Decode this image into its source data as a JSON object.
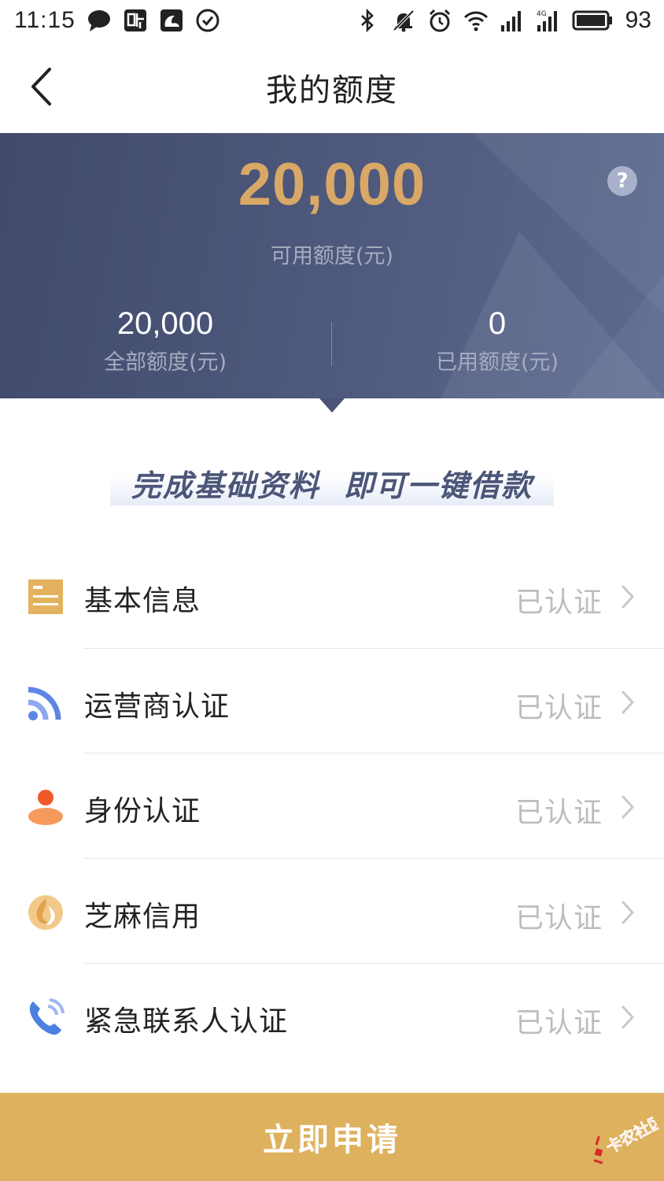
{
  "status_bar": {
    "time": "11:15",
    "left_icons": [
      "chat-bubble-icon",
      "tieba-icon",
      "uc-browser-icon",
      "check-circle-icon"
    ],
    "right_icons": [
      "bluetooth-icon",
      "bell-muted-icon",
      "alarm-icon",
      "wifi-icon",
      "signal-icon",
      "signal-4g-icon",
      "battery-icon"
    ],
    "battery": "93",
    "network_label": "4G"
  },
  "nav": {
    "title": "我的额度",
    "back_icon": "chevron-left-icon"
  },
  "quota": {
    "available_amount": "20,000",
    "available_label": "可用额度(元)",
    "total_value": "20,000",
    "total_label": "全部额度(元)",
    "used_value": "0",
    "used_label": "已用额度(元)",
    "help_glyph": "?"
  },
  "slogan": "完成基础资料  即可一键借款",
  "cert_items": [
    {
      "label": "基本信息",
      "status": "已认证",
      "icon": "document-icon",
      "color": "#e2b25f"
    },
    {
      "label": "运营商认证",
      "status": "已认证",
      "icon": "signal-waves-icon",
      "color": "#5d86e4"
    },
    {
      "label": "身份认证",
      "status": "已认证",
      "icon": "person-icon",
      "color": "#f27a3c"
    },
    {
      "label": "芝麻信用",
      "status": "已认证",
      "icon": "sesame-icon",
      "color": "#e6b063"
    },
    {
      "label": "紧急联系人认证",
      "status": "已认证",
      "icon": "phone-icon",
      "color": "#4d80e0"
    }
  ],
  "apply_button": {
    "label": "立即申请",
    "color": "#deb15e"
  },
  "watermark": "卡农社区",
  "colors": {
    "panel_bg": "#4a5477",
    "amount_gold": "#d9a867",
    "muted_text": "#a6acc0",
    "status_gray": "#bdbdbd"
  }
}
